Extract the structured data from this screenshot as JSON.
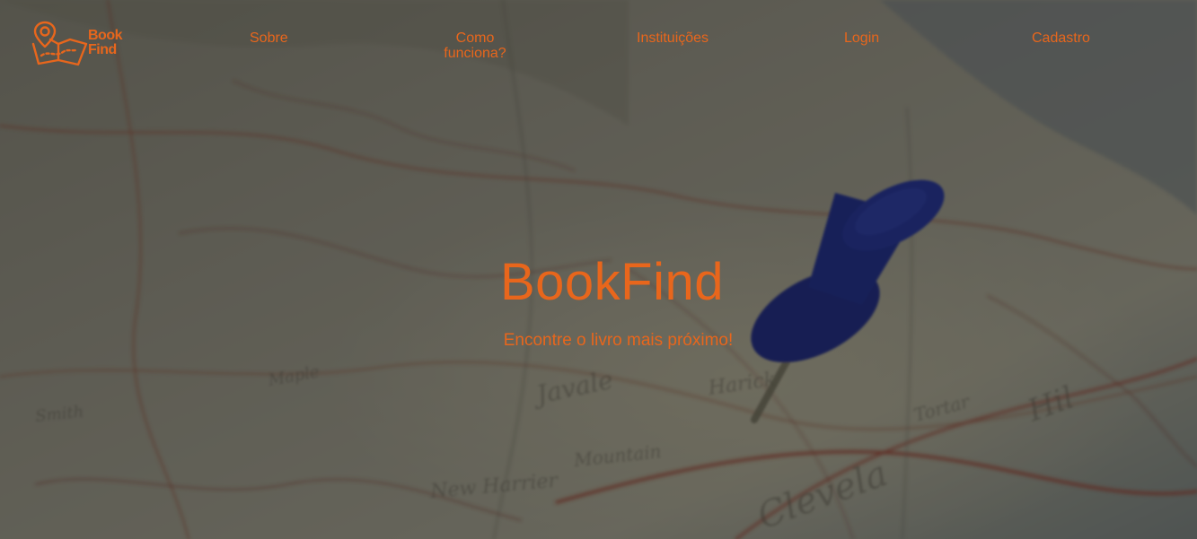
{
  "logo": {
    "line1": "Book",
    "line2": "Find"
  },
  "nav": {
    "sobre": "Sobre",
    "como_funciona": "Como funciona?",
    "instituicoes": "Instituições",
    "login": "Login",
    "cadastro": "Cadastro"
  },
  "hero": {
    "title": "BookFind",
    "subtitle": "Encontre o livro mais próximo!"
  },
  "colors": {
    "accent": "#e8661c",
    "overlay": "#141416",
    "pin": "#1e2f9e"
  },
  "icons": {
    "logo": "map-pin-book-icon",
    "background": "map-with-pushpin-image"
  }
}
